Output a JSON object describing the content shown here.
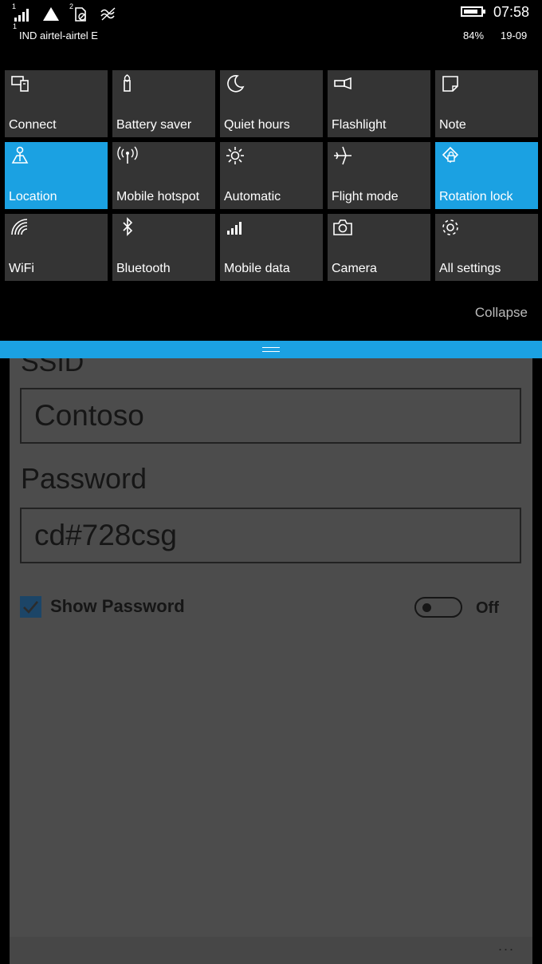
{
  "status_bar": {
    "signal_sup": "1",
    "sim2_sup": "2",
    "carrier_sup": "1",
    "carrier": "IND airtel-airtel E",
    "time": "07:58",
    "battery_percent": "84%",
    "battery_level": 0.84,
    "date": "19-09"
  },
  "quick_actions": [
    {
      "label": "Connect",
      "icon": "connect-icon",
      "active": false
    },
    {
      "label": "Battery saver",
      "icon": "battery-saver-icon",
      "active": false
    },
    {
      "label": "Quiet hours",
      "icon": "moon-icon",
      "active": false
    },
    {
      "label": "Flashlight",
      "icon": "flashlight-icon",
      "active": false
    },
    {
      "label": "Note",
      "icon": "note-icon",
      "active": false
    },
    {
      "label": "Location",
      "icon": "location-icon",
      "active": true
    },
    {
      "label": "Mobile hotspot",
      "icon": "hotspot-icon",
      "active": false
    },
    {
      "label": "Automatic",
      "icon": "brightness-icon",
      "active": false
    },
    {
      "label": "Flight mode",
      "icon": "airplane-icon",
      "active": false
    },
    {
      "label": "Rotation lock",
      "icon": "rotation-lock-icon",
      "active": true
    },
    {
      "label": "WiFi",
      "icon": "wifi-icon",
      "active": false
    },
    {
      "label": "Bluetooth",
      "icon": "bluetooth-icon",
      "active": false
    },
    {
      "label": "Mobile data",
      "icon": "mobile-data-icon",
      "active": false
    },
    {
      "label": "Camera",
      "icon": "camera-icon",
      "active": false
    },
    {
      "label": "All settings",
      "icon": "gear-icon",
      "active": false
    }
  ],
  "collapse_label": "Collapse",
  "form": {
    "ssid_label": "SSID",
    "ssid_value": "Contoso",
    "password_label": "Password",
    "password_value": "cd#728csg",
    "show_password_label": "Show Password",
    "show_password_checked": true,
    "toggle_label": "Off",
    "toggle_on": false,
    "more_label": "..."
  },
  "colors": {
    "accent": "#1ba1e2",
    "tile": "#343434",
    "app_background": "#4c4c4c"
  }
}
